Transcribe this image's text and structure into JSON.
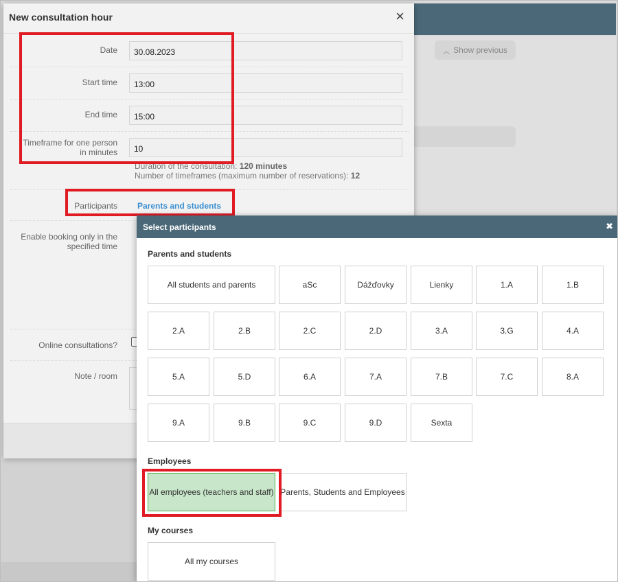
{
  "background": {
    "show_previous": "Show previous",
    "chevron_icon": "chevron-up-icon"
  },
  "dialog": {
    "title": "New consultation hour",
    "close_icon": "×",
    "fields": {
      "date_label": "Date",
      "date_value": "30.08.2023",
      "start_label": "Start time",
      "start_value": "13:00",
      "end_label": "End time",
      "end_value": "15:00",
      "timeframe_label": "Timeframe for one person in minutes",
      "timeframe_value": "10"
    },
    "info": {
      "duration_text": "Duration of the consultation:",
      "duration_value": "120 minutes",
      "timeframes_text": "Number of timeframes (maximum number of reservations):",
      "timeframes_value": "12"
    },
    "participants_label": "Participants",
    "participants_value": "Parents and students",
    "booking_label": "Enable booking only in the specified time",
    "online_label": "Online consultations?",
    "note_label": "Note / room"
  },
  "popup": {
    "title": "Select participants",
    "close_icon": "✖",
    "parents_section": "Parents and students",
    "parents_tiles": [
      "All students and parents",
      "aSc",
      "Dážďovky",
      "Lienky",
      "1.A",
      "1.B",
      "2.A",
      "2.B",
      "2.C",
      "2.D",
      "3.A",
      "3.G",
      "4.A",
      "5.A",
      "5.D",
      "6.A",
      "7.A",
      "7.B",
      "7.C",
      "8.A",
      "9.A",
      "9.B",
      "9.C",
      "9.D",
      "Sexta"
    ],
    "employees_section": "Employees",
    "employee_tiles": [
      "All employees (teachers and staff)",
      "Parents, Students and Employees"
    ],
    "employees_selected": "All employees (teachers and staff)",
    "courses_section": "My courses",
    "course_tiles": [
      "All my courses"
    ]
  }
}
